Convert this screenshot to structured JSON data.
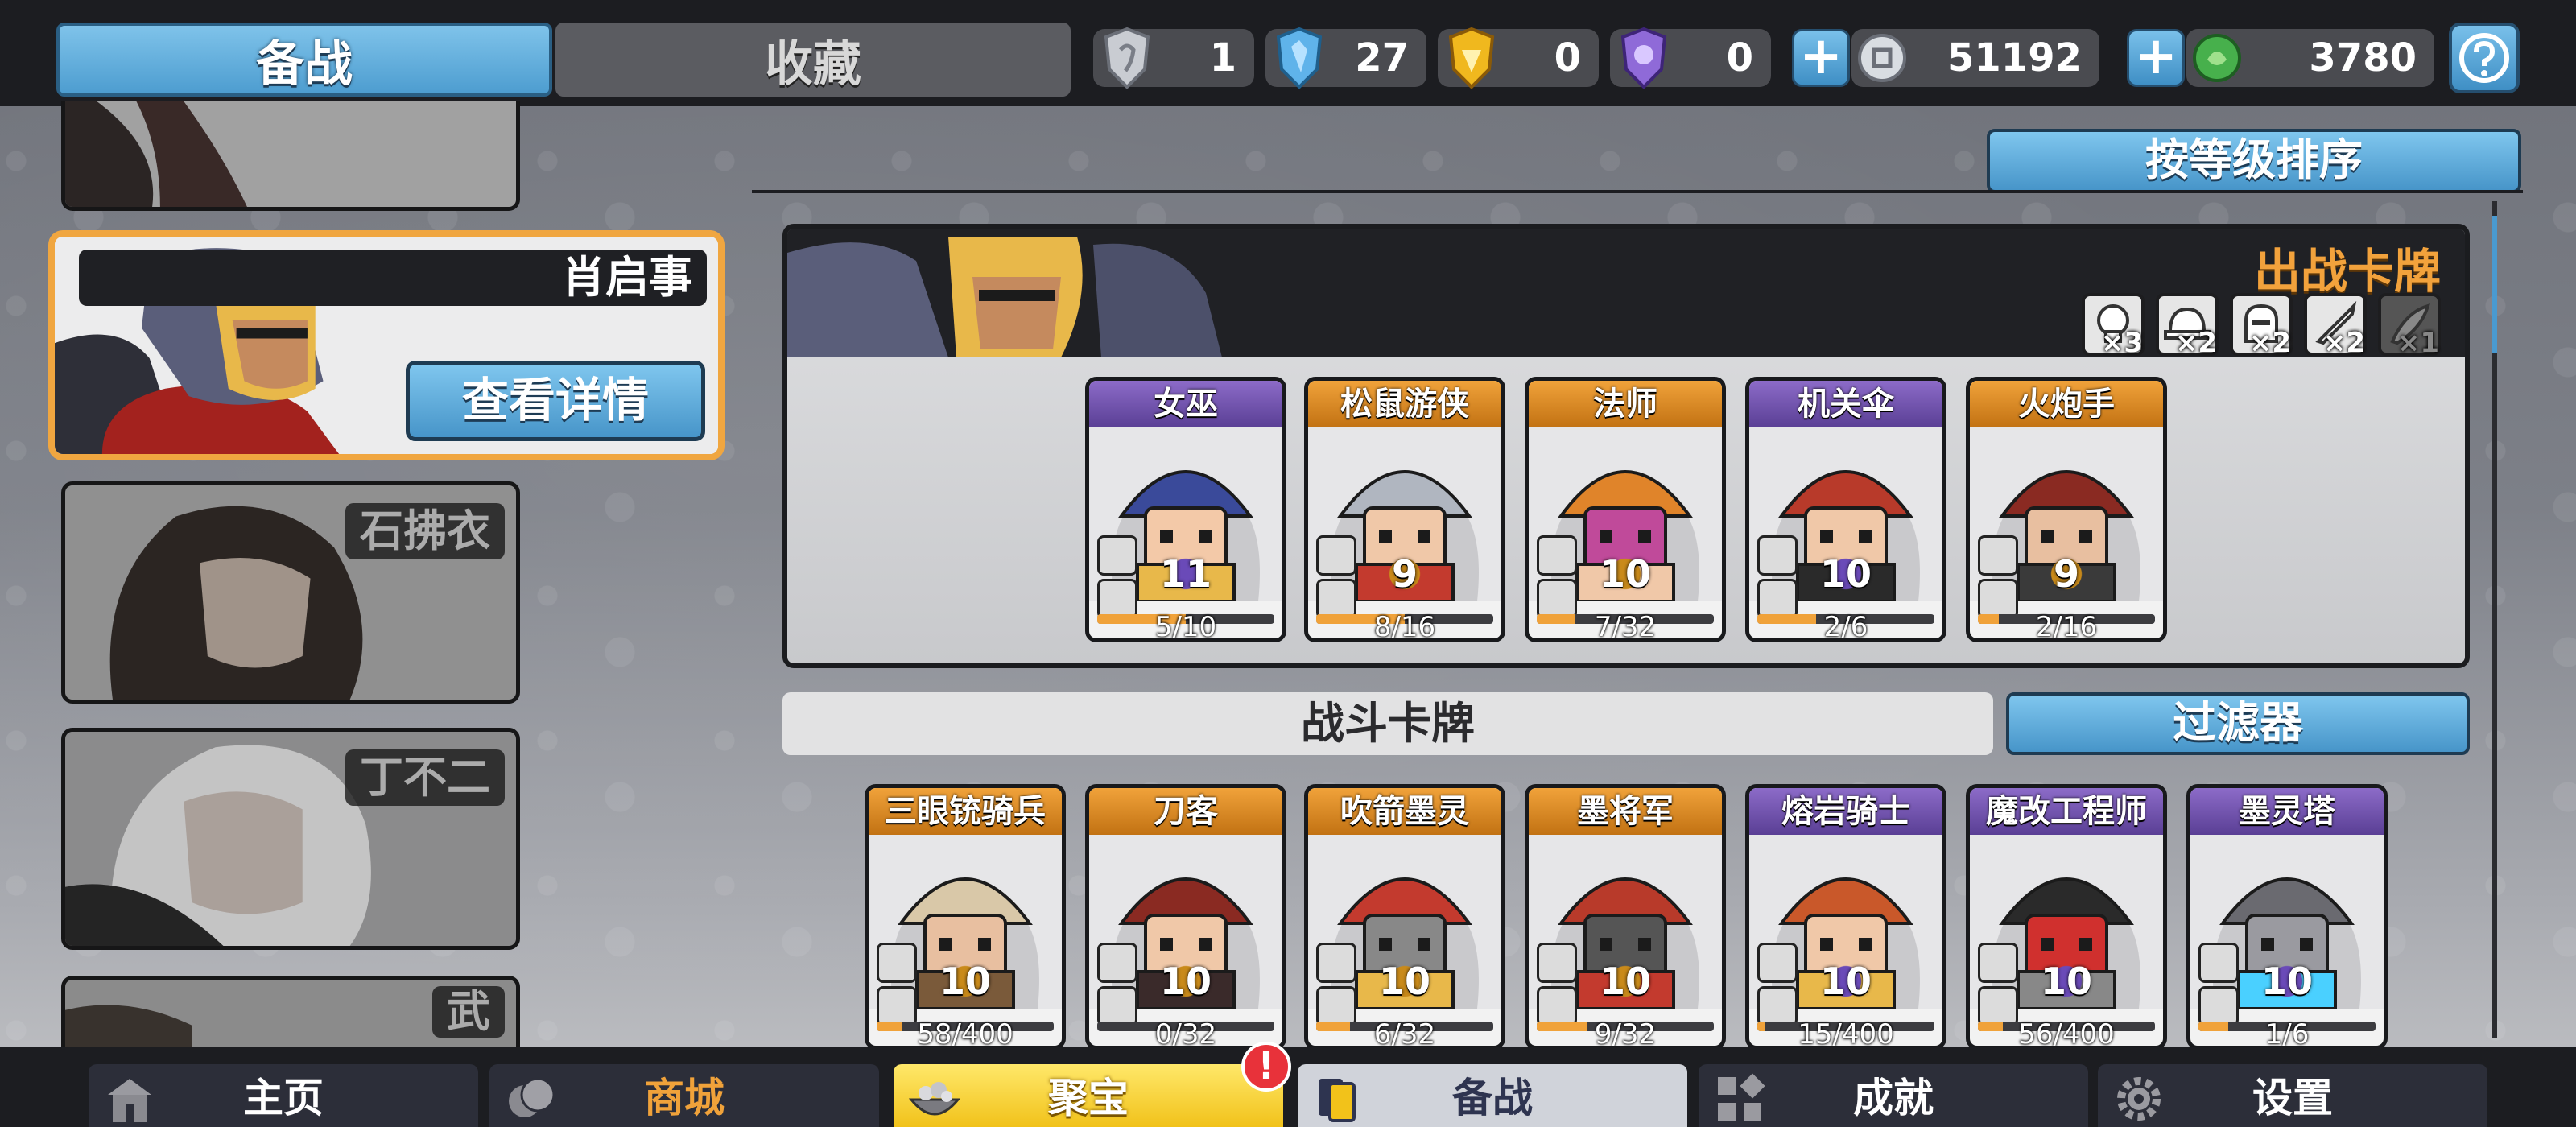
{
  "top_tabs": {
    "active": "备战",
    "inactive": "收藏"
  },
  "resources": [
    {
      "icon": "silver-shield-icon",
      "value": "1",
      "color": "#c9ccd2"
    },
    {
      "icon": "blue-crystal-shield-icon",
      "value": "27",
      "color": "#5fb3ea"
    },
    {
      "icon": "gold-shield-icon",
      "value": "0",
      "color": "#f0b81e"
    },
    {
      "icon": "purple-shield-icon",
      "value": "0",
      "color": "#8f6ad8"
    },
    {
      "icon": "silver-coin-icon",
      "value": "51192",
      "color": "#d9dde2"
    },
    {
      "icon": "green-gem-icon",
      "value": "3780",
      "color": "#47b04c"
    }
  ],
  "heroes": [
    {
      "name": ""
    },
    {
      "name": "肖启事",
      "action": "查看详情",
      "selected": true
    },
    {
      "name": "石拂衣"
    },
    {
      "name": "丁不二"
    },
    {
      "name": "武"
    }
  ],
  "sort_label": "按等级排序",
  "battle_panel": {
    "title": "出战卡牌",
    "type_counts": [
      {
        "icon": "skull-icon",
        "count": "×3"
      },
      {
        "icon": "helmet-icon",
        "count": "×2"
      },
      {
        "icon": "knight-helmet-icon",
        "count": "×2"
      },
      {
        "icon": "sword-icon",
        "count": "×2"
      },
      {
        "icon": "wing-icon",
        "count": "×1",
        "off": true
      }
    ],
    "cards": [
      {
        "name": "女巫",
        "level": "11",
        "count": "5/10",
        "progress": 0.5,
        "rarity": "purple",
        "lvl_color": "#fff"
      },
      {
        "name": "松鼠游侠",
        "level": "9",
        "count": "8/16",
        "progress": 0.5,
        "rarity": "orange",
        "lvl_color": "#fff"
      },
      {
        "name": "法师",
        "level": "10",
        "count": "7/32",
        "progress": 0.22,
        "rarity": "orange",
        "lvl_color": "#fff"
      },
      {
        "name": "机关伞",
        "level": "10",
        "count": "2/6",
        "progress": 0.33,
        "rarity": "purple",
        "lvl_color": "#fff"
      },
      {
        "name": "火炮手",
        "level": "9",
        "count": "2/16",
        "progress": 0.12,
        "rarity": "orange",
        "lvl_color": "#fff"
      }
    ]
  },
  "fight_cards": {
    "title": "战斗卡牌",
    "filter": "过滤器",
    "cards": [
      {
        "name": "三眼铳骑兵",
        "level": "10",
        "count": "58/400",
        "progress": 0.14,
        "rarity": "orange"
      },
      {
        "name": "刀客",
        "level": "10",
        "count": "0/32",
        "progress": 0.0,
        "rarity": "orange"
      },
      {
        "name": "吹箭墨灵",
        "level": "10",
        "count": "6/32",
        "progress": 0.19,
        "rarity": "orange"
      },
      {
        "name": "墨将军",
        "level": "10",
        "count": "9/32",
        "progress": 0.28,
        "rarity": "orange"
      },
      {
        "name": "熔岩骑士",
        "level": "10",
        "count": "15/400",
        "progress": 0.04,
        "rarity": "purple"
      },
      {
        "name": "魔改工程师",
        "level": "10",
        "count": "56/400",
        "progress": 0.14,
        "rarity": "purple"
      },
      {
        "name": "墨灵塔",
        "level": "10",
        "count": "1/6",
        "progress": 0.17,
        "rarity": "purple"
      }
    ]
  },
  "bottom_nav": [
    {
      "label": "主页",
      "icon": "temple-icon"
    },
    {
      "label": "商城",
      "icon": "coins-icon"
    },
    {
      "label": "聚宝",
      "icon": "treasure-bowl-icon",
      "badge": "!"
    },
    {
      "label": "备战",
      "icon": "cards-icon"
    },
    {
      "label": "成就",
      "icon": "achievement-grid-icon"
    },
    {
      "label": "设置",
      "icon": "gear-icon"
    }
  ]
}
